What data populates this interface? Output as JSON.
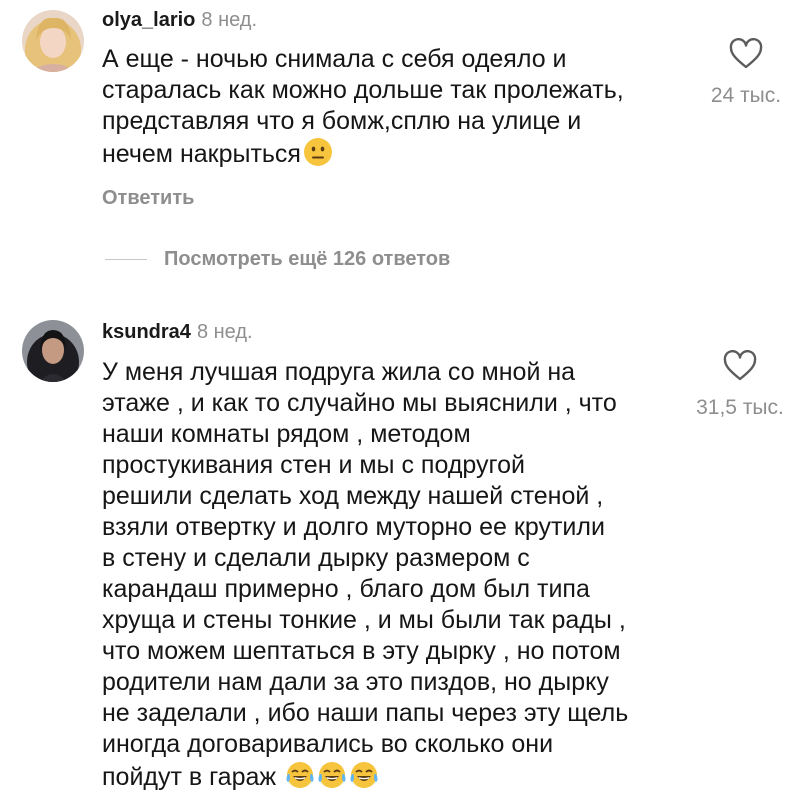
{
  "comments": [
    {
      "username": "olya_lario",
      "age": "8 нед.",
      "text": "А еще - ночью снимала с себя одеяло и\nстаралась как можно дольше так пролежать,\nпредставляя что я бомж,сплю на улице и\nнечем накрыться",
      "emoji": [
        "neutral-face-emoji"
      ],
      "likes": "24 тыс.",
      "reply_label": "Ответить",
      "view_replies_label": "Посмотреть ещё 126 ответов"
    },
    {
      "username": "ksundra4",
      "age": "8 нед.",
      "text": "У меня лучшая подруга жила со мной на\nэтаже , и как то случайно мы выяснили , что\nнаши комнаты рядом , методом\nпростукивания стен и мы с подругой\nрешили сделать ход между нашей стеной ,\nвзяли отвертку и долго муторно ее крутили\nв стену и сделали дырку размером с\nкарандаш примерно , благо дом был типа\nхрущa и стены тонкие , и мы были так рады ,\nчто можем шептаться в эту дырку , но потом\nродители нам дали за это пиздов, но дырку\nне заделали , ибо наши папы через эту щель\nиногда договаривались во сколько они\nпойдут в гараж",
      "emoji": [
        "tears-of-joy-emoji",
        "tears-of-joy-emoji",
        "tears-of-joy-emoji"
      ],
      "likes": "31,5 тыс."
    }
  ],
  "colors": {
    "text": "#161616",
    "secondary": "#8e8e8e",
    "emoji_face": "#f7c43d"
  }
}
